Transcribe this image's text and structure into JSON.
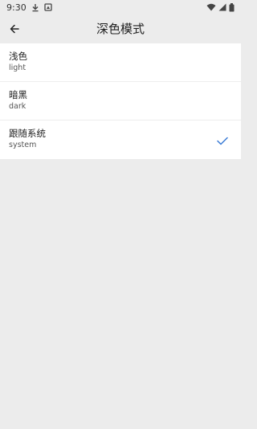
{
  "status_bar": {
    "time": "9:30",
    "icons": [
      "download-icon",
      "notification-icon",
      "wifi-icon",
      "signal-icon",
      "battery-icon"
    ]
  },
  "app_bar": {
    "title": "深色模式",
    "back_icon": "back-arrow-icon"
  },
  "options": [
    {
      "title": "浅色",
      "subtitle": "light",
      "selected": false
    },
    {
      "title": "暗黑",
      "subtitle": "dark",
      "selected": false
    },
    {
      "title": "跟随系统",
      "subtitle": "system",
      "selected": true
    }
  ],
  "colors": {
    "background": "#ececec",
    "list_background": "#ffffff",
    "check": "#3a7bd5"
  }
}
